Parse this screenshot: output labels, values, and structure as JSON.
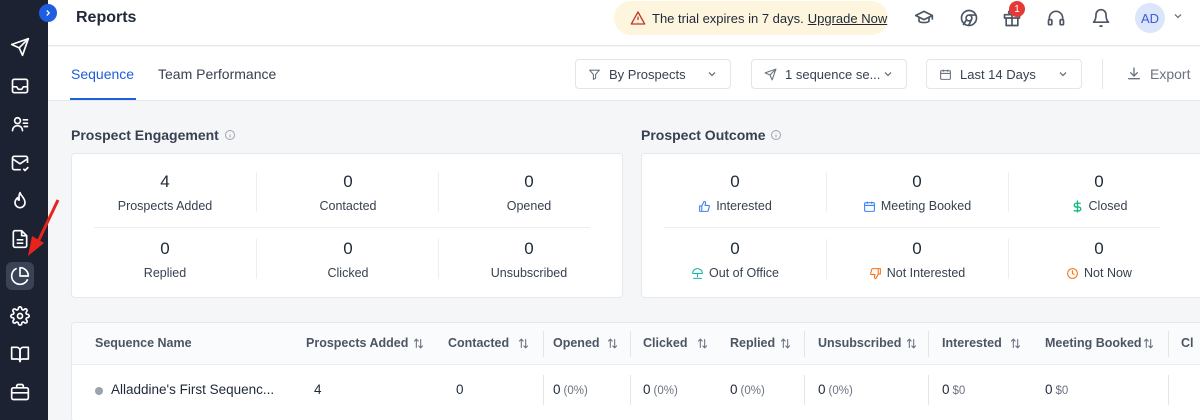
{
  "header": {
    "title": "Reports",
    "trial_text": "The trial expires in 7 days.",
    "trial_link": "Upgrade Now",
    "notification_count": "1",
    "avatar_initials": "AD"
  },
  "tabs": [
    {
      "label": "Sequence",
      "active": true
    },
    {
      "label": "Team Performance",
      "active": false
    }
  ],
  "filters": {
    "prospects": "By Prospects",
    "sequences": "1 sequence se...",
    "date_range": "Last 14 Days",
    "export": "Export"
  },
  "engagement": {
    "title": "Prospect Engagement",
    "metrics": [
      {
        "value": "4",
        "label": "Prospects Added"
      },
      {
        "value": "0",
        "label": "Contacted"
      },
      {
        "value": "0",
        "label": "Opened"
      },
      {
        "value": "0",
        "label": "Replied"
      },
      {
        "value": "0",
        "label": "Clicked"
      },
      {
        "value": "0",
        "label": "Unsubscribed"
      }
    ]
  },
  "outcome": {
    "title": "Prospect Outcome",
    "metrics": [
      {
        "value": "0",
        "label": "Interested",
        "icon": "thumbs-up-icon",
        "color": "#3b82f6"
      },
      {
        "value": "0",
        "label": "Meeting Booked",
        "icon": "calendar-icon",
        "color": "#3b82f6"
      },
      {
        "value": "0",
        "label": "Closed",
        "icon": "dollar-icon",
        "color": "#10b981"
      },
      {
        "value": "0",
        "label": "Out of Office",
        "icon": "beach-umbrella-icon",
        "color": "#14b8a6"
      },
      {
        "value": "0",
        "label": "Not Interested",
        "icon": "thumbs-down-icon",
        "color": "#f97316"
      },
      {
        "value": "0",
        "label": "Not Now",
        "icon": "clock-icon",
        "color": "#f97316"
      }
    ]
  },
  "table": {
    "columns": [
      "Sequence Name",
      "Prospects Added",
      "Contacted",
      "Opened",
      "Clicked",
      "Replied",
      "Unsubscribed",
      "Interested",
      "Meeting Booked",
      "Cl"
    ],
    "rows": [
      {
        "name": "Alladdine's First Sequenc...",
        "prospects_added": "4",
        "contacted": "0",
        "opened": "0",
        "opened_pct": "(0%)",
        "clicked": "0",
        "clicked_pct": "(0%)",
        "replied": "0",
        "replied_pct": "(0%)",
        "unsubscribed": "0",
        "unsubscribed_pct": "(0%)",
        "interested": "0",
        "interested_amt": "$0",
        "meeting_booked": "0",
        "meeting_booked_amt": "$0"
      }
    ]
  },
  "colors": {
    "sidebar": "#1c2232",
    "accent": "#1f5fd6",
    "trial_banner": "#fdf5dd",
    "badge": "#e53935"
  }
}
